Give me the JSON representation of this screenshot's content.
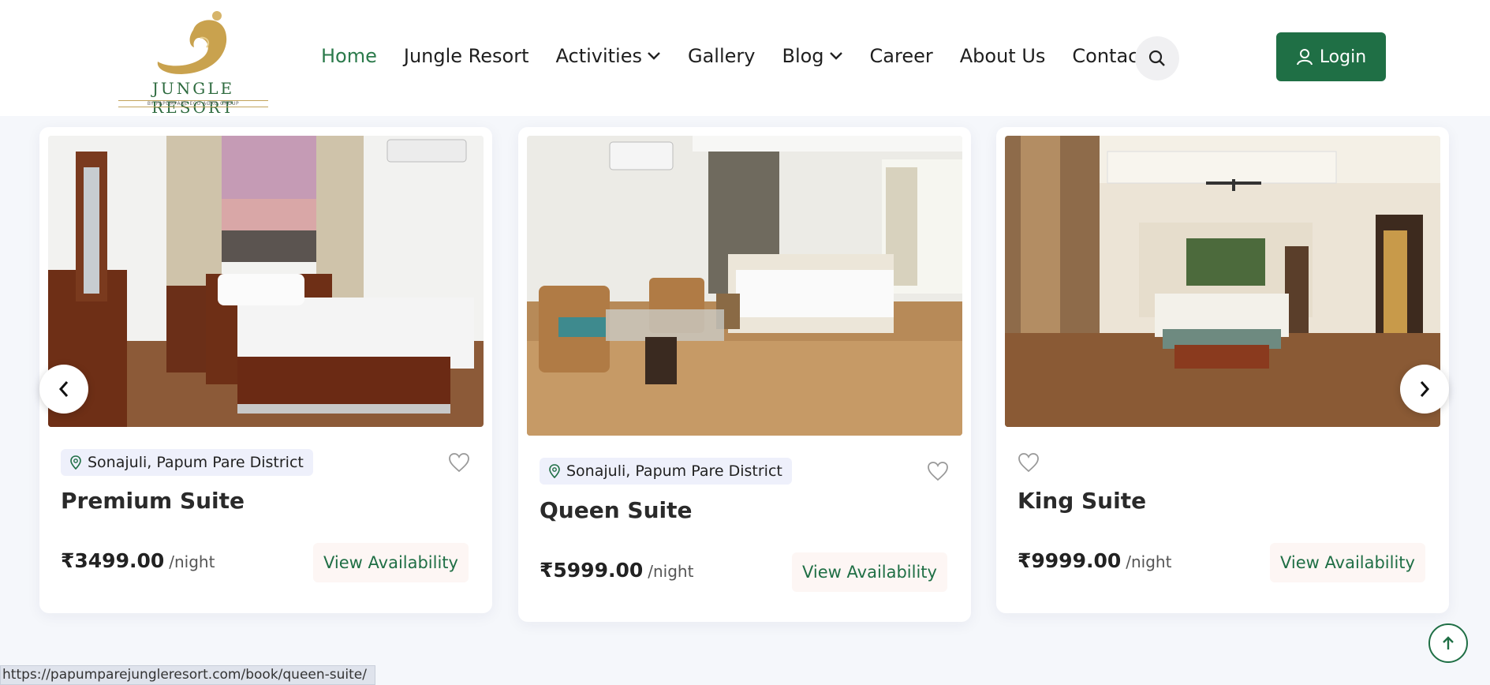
{
  "header": {
    "logo": {
      "title": "JUNGLE RESORT",
      "subtitle": "BY PAPUMPARE ECO AGRO GROUP"
    },
    "nav": [
      {
        "label": "Home",
        "active": true
      },
      {
        "label": "Jungle Resort"
      },
      {
        "label": "Activities",
        "dropdown": true
      },
      {
        "label": "Gallery"
      },
      {
        "label": "Blog",
        "dropdown": true
      },
      {
        "label": "Career"
      },
      {
        "label": "About Us"
      },
      {
        "label": "Contact Us"
      }
    ],
    "search_icon": "search-icon",
    "login_label": "Login",
    "colors": {
      "brand": "#1f6f45",
      "active_nav": "#2b7a4b",
      "logo_gold": "#c2a35a"
    }
  },
  "rooms": [
    {
      "location": "Sonajuli, Papum Pare District",
      "title": "Premium Suite",
      "price": "₹3499.00",
      "per": "/night",
      "cta": "View Availability"
    },
    {
      "location": "Sonajuli, Papum Pare District",
      "title": "Queen Suite",
      "price": "₹5999.00",
      "per": "/night",
      "cta": "View Availability"
    },
    {
      "location": "",
      "title": "King Suite",
      "price": "₹9999.00",
      "per": "/night",
      "cta": "View Availability"
    }
  ],
  "carousel": {
    "prev_icon": "chevron-left-icon",
    "next_icon": "chevron-right-icon"
  },
  "scroll_top_icon": "arrow-up-icon",
  "status_bar": {
    "url": "https://papumparejungleresort.com/book/queen-suite/"
  }
}
